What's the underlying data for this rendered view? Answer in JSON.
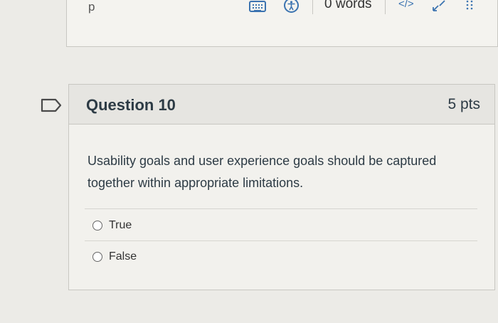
{
  "editor": {
    "path_label": "p",
    "word_count": "0 words",
    "html_toggle": "</>",
    "icons": [
      "keyboard-icon",
      "accessibility-icon",
      "fullscreen-icon",
      "drag-handle-icon"
    ]
  },
  "question": {
    "flag_icon": "flag-icon",
    "title": "Question 10",
    "points": "5 pts",
    "text": "Usability goals and user experience goals should be captured together within appropriate limitations.",
    "answers": [
      {
        "label": "True",
        "selected": false
      },
      {
        "label": "False",
        "selected": false
      }
    ]
  },
  "colors": {
    "accent": "#3b73b0",
    "text": "#2d3b45",
    "header_bg": "#e6e5e1"
  }
}
